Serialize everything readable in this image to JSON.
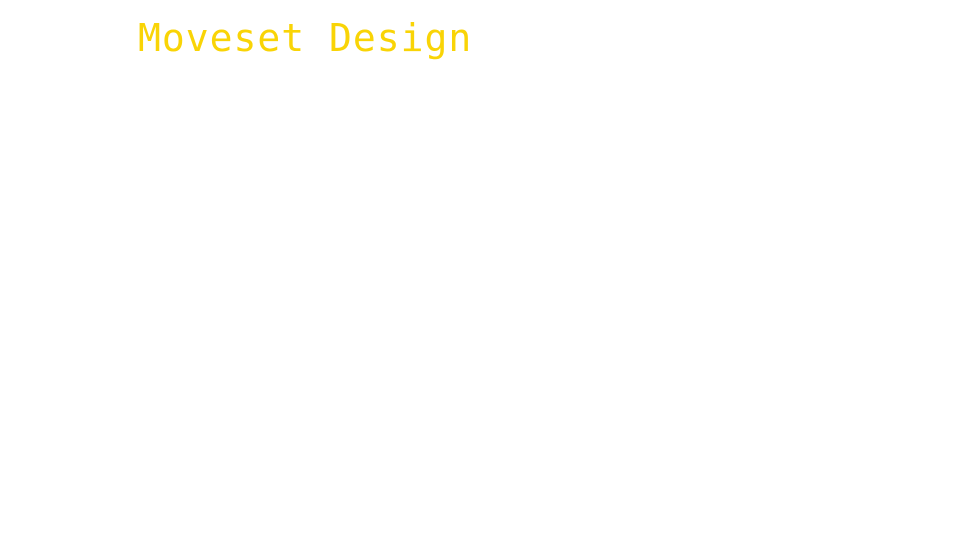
{
  "slide": {
    "title": "Moveset Design",
    "title_color": "#f9d406",
    "background_color": "#ffffff"
  }
}
